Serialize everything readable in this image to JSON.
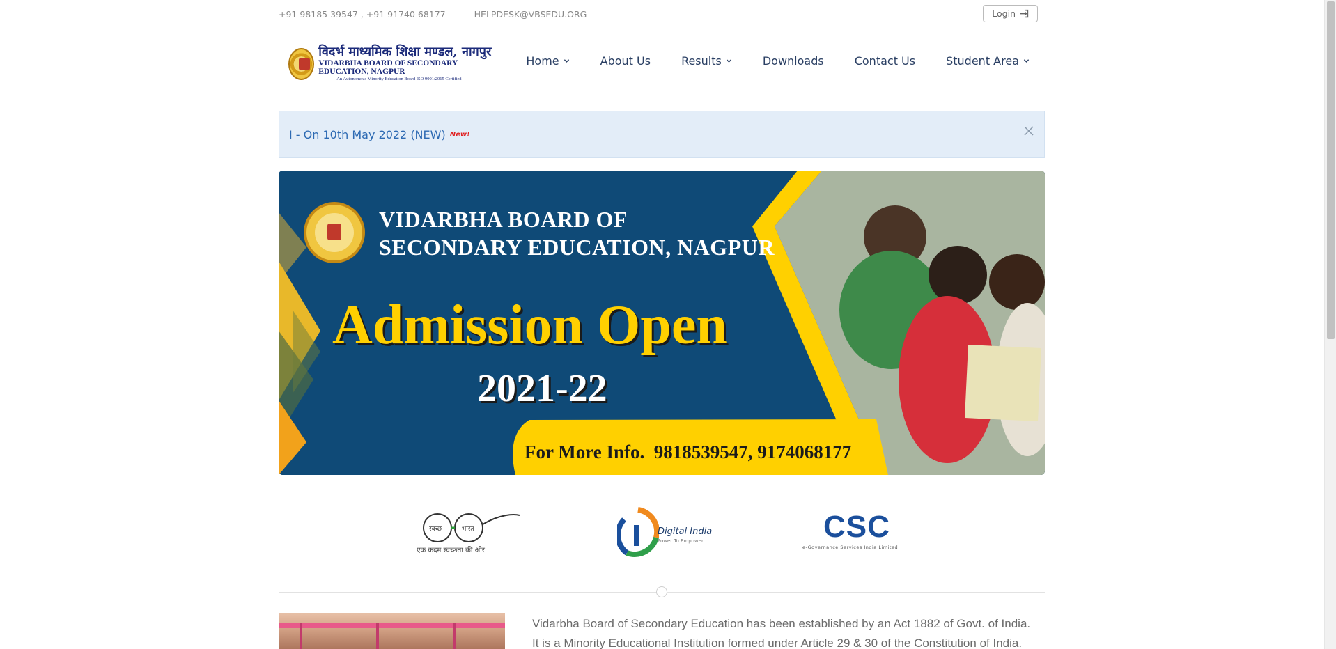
{
  "topbar": {
    "phones": "+91 98185 39547 , +91 91740 68177",
    "email": "HELPDESK@VBSEDU.ORG",
    "login_label": "Login"
  },
  "logo": {
    "hindi": "विदर्भ माध्यमिक शिक्षा मण्डल, नागपुर",
    "english": "VIDARBHA BOARD OF SECONDARY EDUCATION, NAGPUR",
    "sub": "An Autonomous Minority Education Board   ISO 9001:2015 Certified"
  },
  "nav": {
    "items": [
      {
        "label": "Home",
        "dropdown": true
      },
      {
        "label": "About Us",
        "dropdown": false
      },
      {
        "label": "Results",
        "dropdown": true
      },
      {
        "label": "Downloads",
        "dropdown": false
      },
      {
        "label": "Contact Us",
        "dropdown": false
      },
      {
        "label": "Student Area",
        "dropdown": true
      }
    ]
  },
  "notice": {
    "text": "I - On 10th May 2022 (NEW)",
    "badge": "New!"
  },
  "banner": {
    "title_line1": "VIDARBHA BOARD OF",
    "title_line2": "SECONDARY EDUCATION, NAGPUR",
    "headline": "Admission Open",
    "year": "2021-22",
    "info": "For More Info.  9818539547, 9174068177",
    "colors": {
      "navy": "#0f4a77",
      "yellow": "#ffd000",
      "orange": "#f2a21b"
    }
  },
  "partners": {
    "swachh_left": "स्वच्छ",
    "swachh_right": "भारत",
    "swachh_tagline": "एक कदम स्वच्छता की ओर",
    "digital_india": "Digital India",
    "digital_india_tag": "Power To Empower",
    "csc": "CSC",
    "csc_tag": "e-Governance Services India Limited"
  },
  "about": {
    "line1": "Vidarbha Board of Secondary Education has been established by an Act 1882 of Govt. of India.",
    "line2": "It is a Minority Educational Institution formed under Article 29 & 30 of the Constitution of India."
  }
}
